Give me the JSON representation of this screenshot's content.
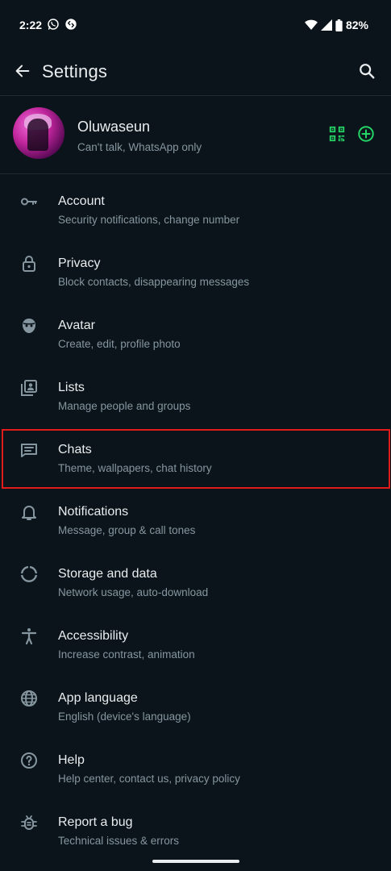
{
  "status_bar": {
    "time": "2:22",
    "battery": "82%",
    "icons": [
      "whatsapp-icon",
      "shazam-icon",
      "wifi-icon",
      "signal-icon",
      "battery-icon"
    ]
  },
  "app_bar": {
    "title": "Settings",
    "back_icon": "arrow-left-icon",
    "search_icon": "search-icon"
  },
  "profile": {
    "name": "Oluwaseun",
    "status": "Can't talk, WhatsApp only",
    "qr_icon": "qr-code-icon",
    "add_icon": "add-circle-icon"
  },
  "settings": {
    "items": [
      {
        "label": "Account",
        "sub": "Security notifications, change number",
        "icon": "key-icon"
      },
      {
        "label": "Privacy",
        "sub": "Block contacts, disappearing messages",
        "icon": "lock-icon"
      },
      {
        "label": "Avatar",
        "sub": "Create, edit, profile photo",
        "icon": "avatar-face-icon"
      },
      {
        "label": "Lists",
        "sub": "Manage people and groups",
        "icon": "contact-list-icon"
      },
      {
        "label": "Chats",
        "sub": "Theme, wallpapers, chat history",
        "icon": "chat-icon"
      },
      {
        "label": "Notifications",
        "sub": "Message, group & call tones",
        "icon": "bell-icon"
      },
      {
        "label": "Storage and data",
        "sub": "Network usage, auto-download",
        "icon": "storage-circle-icon"
      },
      {
        "label": "Accessibility",
        "sub": "Increase contrast, animation",
        "icon": "accessibility-icon"
      },
      {
        "label": "App language",
        "sub": "English (device's language)",
        "icon": "globe-icon"
      },
      {
        "label": "Help",
        "sub": "Help center, contact us, privacy policy",
        "icon": "help-circle-icon"
      },
      {
        "label": "Report a bug",
        "sub": "Technical issues & errors",
        "icon": "bug-icon"
      }
    ]
  },
  "colors": {
    "background": "#0b141a",
    "accent": "#25d366",
    "text_primary": "#e9edef",
    "text_secondary": "#8696a0",
    "highlight": "#e01b1b"
  }
}
